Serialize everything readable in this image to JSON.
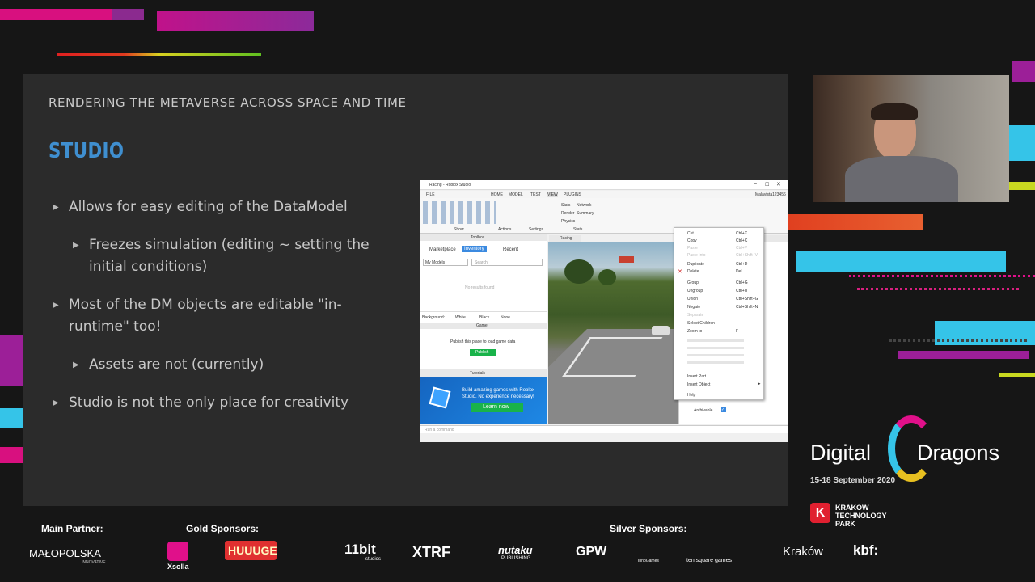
{
  "slide": {
    "header": "RENDERING THE METAVERSE ACROSS SPACE AND TIME",
    "title": "STUDIO",
    "bullets": [
      {
        "level": 1,
        "text": "Allows for easy editing of the DataModel"
      },
      {
        "level": 2,
        "line1": "Freezes simulation (editing ~ setting the",
        "line2": "initial conditions)"
      },
      {
        "level": 1,
        "line1": "Most of the DM objects are editable \"in-",
        "line2": "runtime\" too!"
      },
      {
        "level": 2,
        "text": "Assets are not (currently)"
      },
      {
        "level": 1,
        "text": "Studio is not the only place for creativity"
      }
    ]
  },
  "studio": {
    "window_title": "Racing - Roblox Studio",
    "menu": [
      "FILE",
      "HOME",
      "MODEL",
      "TEST",
      "VIEW",
      "PLUGINS"
    ],
    "username": "Malavista123456",
    "ribbon_groups": [
      "Show",
      "Actions",
      "Settings",
      "Stats"
    ],
    "stats_items": [
      "Stats",
      "Network",
      "Render",
      "Summary",
      "Physics"
    ],
    "toolbox": {
      "title": "Toolbox",
      "tabs": [
        "Marketplace",
        "Inventory",
        "Recent"
      ],
      "dropdown": "My Models",
      "search_placeholder": "Search",
      "empty_text": "No results found",
      "background_label": "Background:",
      "background_options": [
        "White",
        "Black",
        "None"
      ]
    },
    "game_panel": {
      "title": "Game",
      "message": "Publish this place to load game data",
      "button": "Publish"
    },
    "tutorials": {
      "title": "Tutorials",
      "text": "Build amazing games with Roblox Studio. No experience necessary!",
      "button": "Learn now"
    },
    "viewport_tab": "Racing",
    "context_menu": [
      {
        "label": "Cut",
        "shortcut": "Ctrl+X"
      },
      {
        "label": "Copy",
        "shortcut": "Ctrl+C"
      },
      {
        "label": "Paste",
        "shortcut": "Ctrl+V"
      },
      {
        "label": "Paste Into",
        "shortcut": "Ctrl+Shift+V"
      },
      {
        "label": "Duplicate",
        "shortcut": "Ctrl+D"
      },
      {
        "label": "Delete",
        "shortcut": "Del"
      },
      {
        "label": "Group",
        "shortcut": "Ctrl+G"
      },
      {
        "label": "Ungroup",
        "shortcut": "Ctrl+U"
      },
      {
        "label": "Union",
        "shortcut": "Ctrl+Shift+G"
      },
      {
        "label": "Negate",
        "shortcut": "Ctrl+Shift+N"
      },
      {
        "label": "Separate",
        "shortcut": ""
      },
      {
        "label": "Select Children",
        "shortcut": ""
      },
      {
        "label": "Zoom to",
        "shortcut": "F"
      },
      {
        "label": "Insert Part",
        "shortcut": ""
      },
      {
        "label": "Insert Object",
        "shortcut": ""
      },
      {
        "label": "Help",
        "shortcut": ""
      }
    ],
    "properties": {
      "archivable_label": "Archivable"
    },
    "command_placeholder": "Run a command"
  },
  "sponsors": {
    "main_partner_label": "Main Partner:",
    "gold_label": "Gold Sponsors:",
    "silver_label": "Silver Sponsors:",
    "malopolska": "MAŁOPOLSKA",
    "malopolska_sub": "INNOVATIVE",
    "xsolla": "Xsolla",
    "huuuge": "HUUUGE",
    "elevenbit": "11bit",
    "elevenbit_sub": "studios",
    "xtrf": "XTRF",
    "nutaku": "nutaku",
    "nutaku_sub": "PUBLISHING",
    "gpw": "GPW",
    "innogames": "InnoGames",
    "tensquare": "ten square games",
    "krakow": "Kraków",
    "kbf": "kbf:"
  },
  "event": {
    "title_left": "Digital",
    "title_right": "Dragons",
    "dates": "15-18 September 2020",
    "venue": "KRAKOW TECHNOLOGY PARK"
  },
  "colors": {
    "slide_bg": "#2b2b2b",
    "accent_blue": "#3f8fd0",
    "magenta": "#e0108a",
    "cyan": "#35c4e8"
  }
}
